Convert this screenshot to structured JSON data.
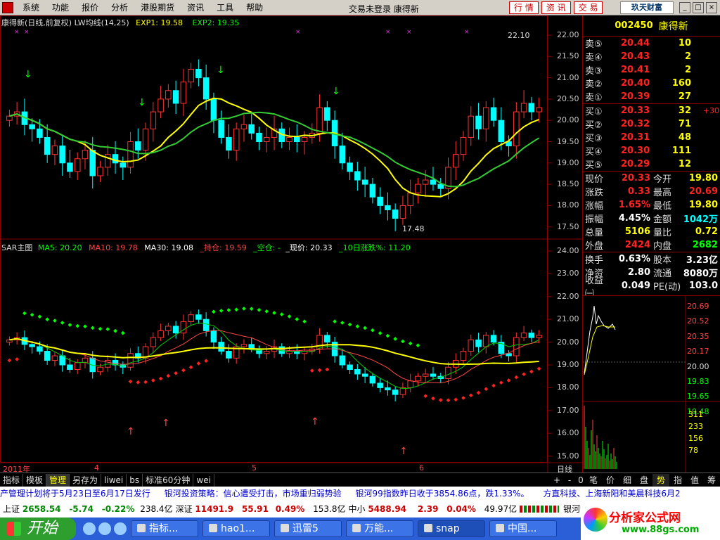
{
  "menu": [
    "系统",
    "功能",
    "报价",
    "分析",
    "港股期货",
    "资讯",
    "工具",
    "帮助"
  ],
  "login_status": "交易未登录 康得新",
  "tool_buttons": [
    "行 情",
    "资 讯",
    "交 易"
  ],
  "brand_text": "玖天财富",
  "window_controls": [
    "_",
    "□",
    "×"
  ],
  "k_header": {
    "title": "康得新(日线,前复权)",
    "indicator": "LW均线(14,25)",
    "exp1": "EXP1: 19.58",
    "exp2": "EXP2: 19.35"
  },
  "sar_header": {
    "title": "SAR主图",
    "ma5": "MA5: 20.20",
    "ma10": "MA10: 19.78",
    "ma30": "MA30: 19.08",
    "hold": "_持仓: 19.59",
    "empty": "_空仓: -",
    "now": "_现价: 20.33",
    "ten_day": "_10日涨跌%: 11.20"
  },
  "price_axis_top": [
    "22.00",
    "21.50",
    "21.00",
    "20.50",
    "20.00",
    "19.50",
    "19.00",
    "18.50",
    "18.00",
    "17.50"
  ],
  "price_axis_bottom": [
    "24.00",
    "23.00",
    "22.00",
    "21.00",
    "20.00",
    "19.00",
    "18.00",
    "17.00",
    "16.00",
    "15.00"
  ],
  "annotations": {
    "high": "22.10",
    "low": "17.48"
  },
  "date_axis": {
    "year": "2011年",
    "m4": "4",
    "m5": "5",
    "m6": "6",
    "period": "日线"
  },
  "stock": {
    "code": "002450",
    "name": "康得新"
  },
  "sell_orders": [
    {
      "label": "卖⑤",
      "price": "20.44",
      "vol": "10"
    },
    {
      "label": "卖④",
      "price": "20.43",
      "vol": "2"
    },
    {
      "label": "卖③",
      "price": "20.41",
      "vol": "2"
    },
    {
      "label": "卖②",
      "price": "20.40",
      "vol": "160"
    },
    {
      "label": "卖①",
      "price": "20.39",
      "vol": "27"
    }
  ],
  "buy_orders": [
    {
      "label": "买①",
      "price": "20.33",
      "vol": "32",
      "chg": "+30"
    },
    {
      "label": "买②",
      "price": "20.32",
      "vol": "71",
      "chg": ""
    },
    {
      "label": "买③",
      "price": "20.31",
      "vol": "48",
      "chg": ""
    },
    {
      "label": "买④",
      "price": "20.30",
      "vol": "111",
      "chg": ""
    },
    {
      "label": "买⑤",
      "price": "20.29",
      "vol": "12",
      "chg": ""
    }
  ],
  "stats": [
    {
      "l1": "现价",
      "v1": "20.33",
      "c1": "red",
      "l2": "今开",
      "v2": "19.80",
      "c2": "yellow"
    },
    {
      "l1": "涨跌",
      "v1": "0.33",
      "c1": "red",
      "l2": "最高",
      "v2": "20.69",
      "c2": "red"
    },
    {
      "l1": "涨幅",
      "v1": "1.65%",
      "c1": "red",
      "l2": "最低",
      "v2": "19.80",
      "c2": "yellow"
    },
    {
      "l1": "振幅",
      "v1": "4.45%",
      "c1": "white",
      "l2": "金额",
      "v2": "1042万",
      "c2": "cyan"
    },
    {
      "l1": "总量",
      "v1": "5106",
      "c1": "yellow",
      "l2": "量比",
      "v2": "0.72",
      "c2": "yellow"
    },
    {
      "l1": "外盘",
      "v1": "2424",
      "c1": "red",
      "l2": "内盘",
      "v2": "2682",
      "c2": "green"
    },
    {
      "l1": "换手",
      "v1": "0.63%",
      "c1": "white",
      "l2": "股本",
      "v2": "3.23亿",
      "c2": "white"
    },
    {
      "l1": "净资",
      "v1": "2.80",
      "c1": "white",
      "l2": "流通",
      "v2": "8080万",
      "c2": "white"
    },
    {
      "l1": "收益㈠",
      "v1": "0.049",
      "c1": "white",
      "l2": "PE(动)",
      "v2": "103.0",
      "c2": "white"
    }
  ],
  "mini_price_axis": [
    "20.69",
    "20.52",
    "20.35",
    "20.17",
    "20.00",
    "19.83",
    "19.65",
    "19.48"
  ],
  "mini_vol_axis": [
    "311",
    "233",
    "156",
    "78"
  ],
  "bottom_tabs": [
    "指标",
    "模板",
    "管理",
    "另存为",
    "liwei",
    "bs",
    "标准60分钟",
    "wei"
  ],
  "right_tabs": [
    "+",
    "-",
    "0",
    "笔",
    "价",
    "细",
    "盘",
    "势",
    "指",
    "值",
    "筹"
  ],
  "ticker": [
    "产管理计划将于5月23日至6月17日发行",
    "银河投资策略：信心遭受打击，市场重归弱势验",
    "银河99指数昨日收于3854.86点，跌1.33%。",
    "方直科技、上海新阳和美晨科技6月2"
  ],
  "indexes": [
    {
      "name": "上证",
      "value": "2658.54",
      "chg": "-5.74",
      "pct": "-0.22%",
      "amt": "238.4亿"
    },
    {
      "name": "深证",
      "value": "11491.9",
      "chg": "55.91",
      "pct": "0.49%",
      "amt": "153.8亿"
    },
    {
      "name": "中小",
      "value": "5488.94",
      "chg": "2.39",
      "pct": "0.04%",
      "amt": "49.97亿"
    }
  ],
  "broker": "银河证券北",
  "start_label": "开始",
  "tasks": [
    "指标...",
    "hao1...",
    "迅雷5",
    "万能...",
    "snap",
    "中国..."
  ],
  "watermark": {
    "title": "分析家公式网",
    "url": "www.88gs.com"
  }
}
